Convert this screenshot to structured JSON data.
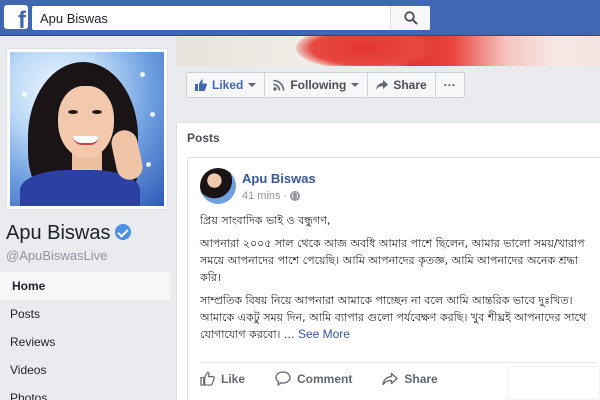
{
  "topbar": {
    "logo_letter": "f",
    "search_value": "Apu Biswas",
    "search_icon": "search-icon",
    "brand_color": "#4267b2"
  },
  "profile": {
    "name": "Apu Biswas",
    "handle": "@ApuBiswasLive",
    "verified_icon": "verified-badge-icon"
  },
  "left_nav": {
    "items": [
      {
        "label": "Home",
        "active": true
      },
      {
        "label": "Posts",
        "active": false
      },
      {
        "label": "Reviews",
        "active": false
      },
      {
        "label": "Videos",
        "active": false
      },
      {
        "label": "Photos",
        "active": false
      }
    ]
  },
  "action_bar": {
    "liked_label": "Liked",
    "following_label": "Following",
    "share_label": "Share",
    "more_label": "···"
  },
  "posts": {
    "heading": "Posts",
    "post": {
      "author": "Apu Biswas",
      "time": "41 mins",
      "separator": "·",
      "paragraphs": [
        "প্রিয় সাংবাদিক ভাই ও বন্ধুগণ,",
        "আপনারা ২০০৫ সাল থেকে আজ অবধি আমার পাশে ছিলেন, আমার ভালো সময়/খারাপ সময়ে আপনাদের পাশে পেয়েছি। আমি আপনাদের কৃতজ্ঞ, আমি আপনাদের অনেক শ্রদ্ধা করি।",
        "সাম্প্রতিক বিষয় নিয়ে আপনারা আমাকে পাচ্ছেন না বলে আমি আন্তরিক ভাবে দুঃখিত। আমাকে একটু সময় দিন, আমি ব্যাপার গুলো পর্যবেক্ষণ করছি। খুব শীঘ্রই আপনাদের সাথে যোগাযোগ করবো।"
      ],
      "ellipsis": " ... ",
      "see_more": "See More",
      "like_label": "Like",
      "comment_label": "Comment",
      "share_label": "Share"
    }
  }
}
